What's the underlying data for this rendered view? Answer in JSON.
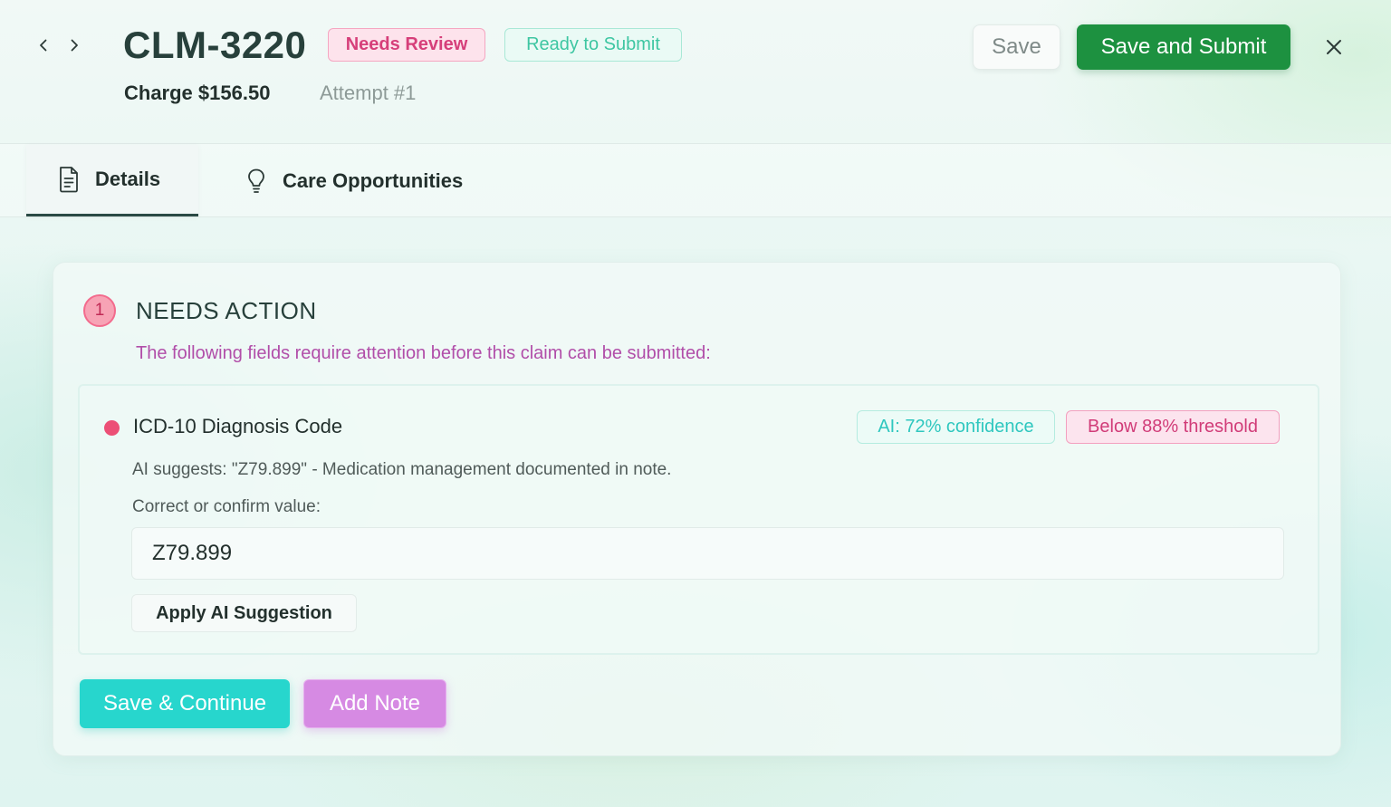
{
  "header": {
    "claim_id": "CLM-3220",
    "status_badges": {
      "needs_review": "Needs Review",
      "ready_to_submit": "Ready to Submit"
    },
    "charge": "Charge $156.50",
    "attempt": "Attempt #1",
    "save_label": "Save",
    "save_submit_label": "Save and Submit",
    "icons": {
      "prev": "chevron-left-icon",
      "next": "chevron-right-icon",
      "close": "close-icon"
    }
  },
  "tabs": [
    {
      "label": "Details",
      "icon": "document-icon",
      "active": true
    },
    {
      "label": "Care Opportunities",
      "icon": "lightbulb-icon",
      "active": false
    }
  ],
  "needs_action": {
    "step_number": "1",
    "title": "NEEDS ACTION",
    "subtitle": "The following fields require attention before this claim can be submitted:",
    "field": {
      "label": "ICD-10 Diagnosis Code",
      "confidence_badge": "AI: 72% confidence",
      "threshold_badge": "Below 88% threshold",
      "ai_suggestion": "AI suggests: \"Z79.899\" - Medication management documented in note.",
      "confirm_label": "Correct or confirm value:",
      "value": "Z79.899",
      "apply_label": "Apply AI Suggestion"
    },
    "save_continue_label": "Save & Continue",
    "add_note_label": "Add Note"
  },
  "colors": {
    "primary_green": "#1d9140",
    "teal_accent": "#27d6cd",
    "purple_accent": "#d68ae3",
    "pink_alert": "#ec4f76",
    "magenta_text": "#b14ea9"
  }
}
